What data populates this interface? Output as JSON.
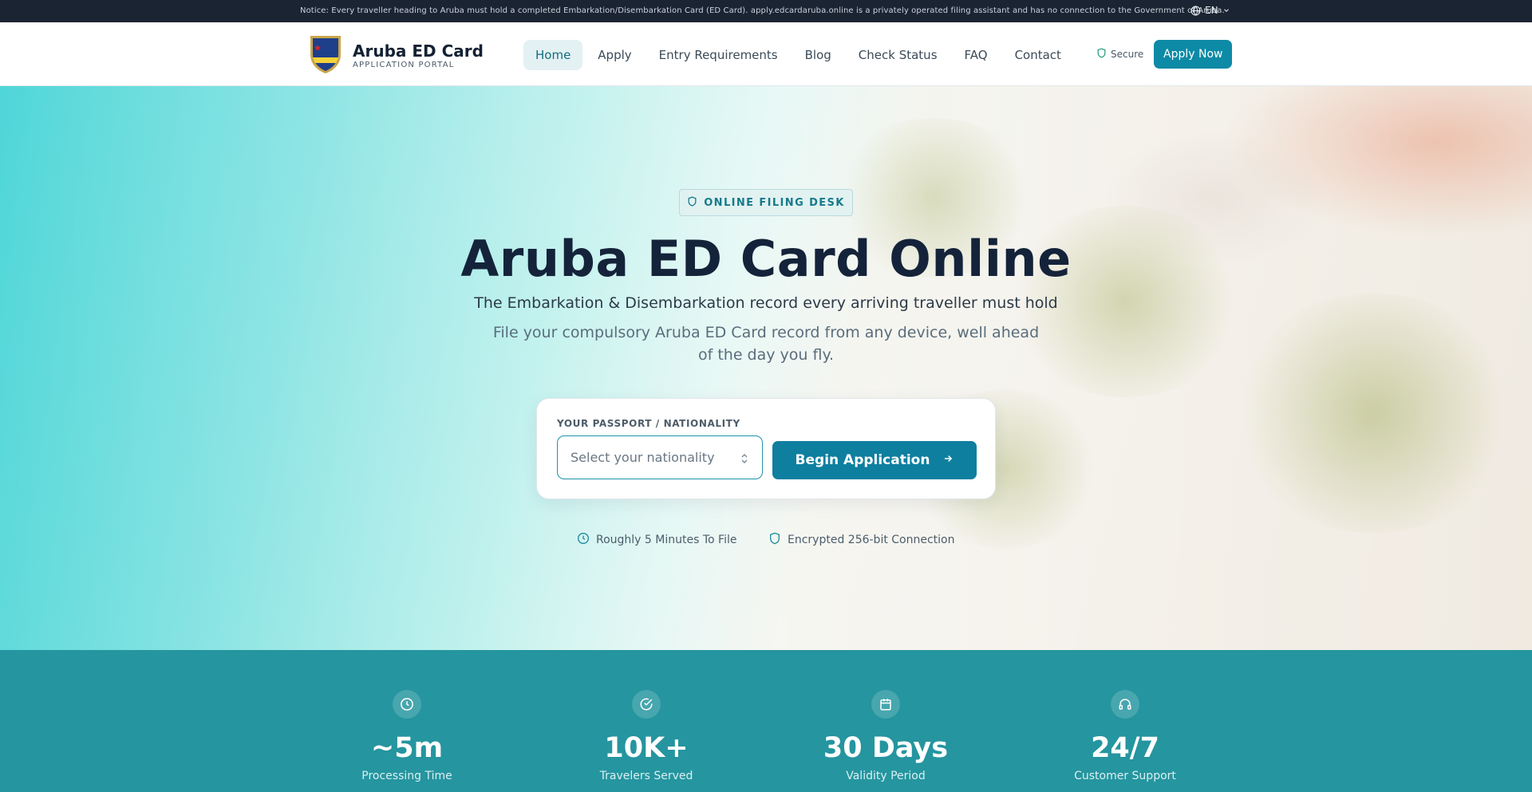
{
  "notice": {
    "text": "Notice: Every traveller heading to Aruba must hold a completed Embarkation/Disembarkation Card (ED Card). apply.edcardaruba.online is a privately operated filing assistant and has no connection to the Government of Aruba.",
    "language": "EN"
  },
  "header": {
    "brand_name": "Aruba ED Card",
    "brand_subtitle": "APPLICATION PORTAL",
    "nav": [
      {
        "label": "Home",
        "active": true
      },
      {
        "label": "Apply"
      },
      {
        "label": "Entry Requirements"
      },
      {
        "label": "Blog"
      },
      {
        "label": "Check Status"
      },
      {
        "label": "FAQ"
      },
      {
        "label": "Contact"
      }
    ],
    "secure_label": "Secure",
    "cta_label": "Apply Now"
  },
  "hero": {
    "badge": "ONLINE FILING DESK",
    "title": "Aruba ED Card Online",
    "subtitle": "The Embarkation & Disembarkation record every arriving traveller must hold",
    "description": "File your compulsory Aruba ED Card record from any device, well ahead of the day you fly.",
    "form": {
      "label": "YOUR PASSPORT / NATIONALITY",
      "select_placeholder": "Select your nationality",
      "button_label": "Begin Application"
    },
    "features": [
      {
        "icon": "clock-icon",
        "label": "Roughly 5 Minutes To File"
      },
      {
        "icon": "shield-icon",
        "label": "Encrypted 256-bit Connection"
      }
    ]
  },
  "stats": [
    {
      "icon": "clock-icon",
      "value": "~5m",
      "label": "Processing Time"
    },
    {
      "icon": "check-circle-icon",
      "value": "10K+",
      "label": "Travelers Served"
    },
    {
      "icon": "calendar-icon",
      "value": "30 Days",
      "label": "Validity Period"
    },
    {
      "icon": "headphones-icon",
      "value": "24/7",
      "label": "Customer Support"
    }
  ],
  "colors": {
    "accent": "#0d8aa6",
    "stats_band": "#25959f",
    "notice_bar": "#1b2432"
  }
}
